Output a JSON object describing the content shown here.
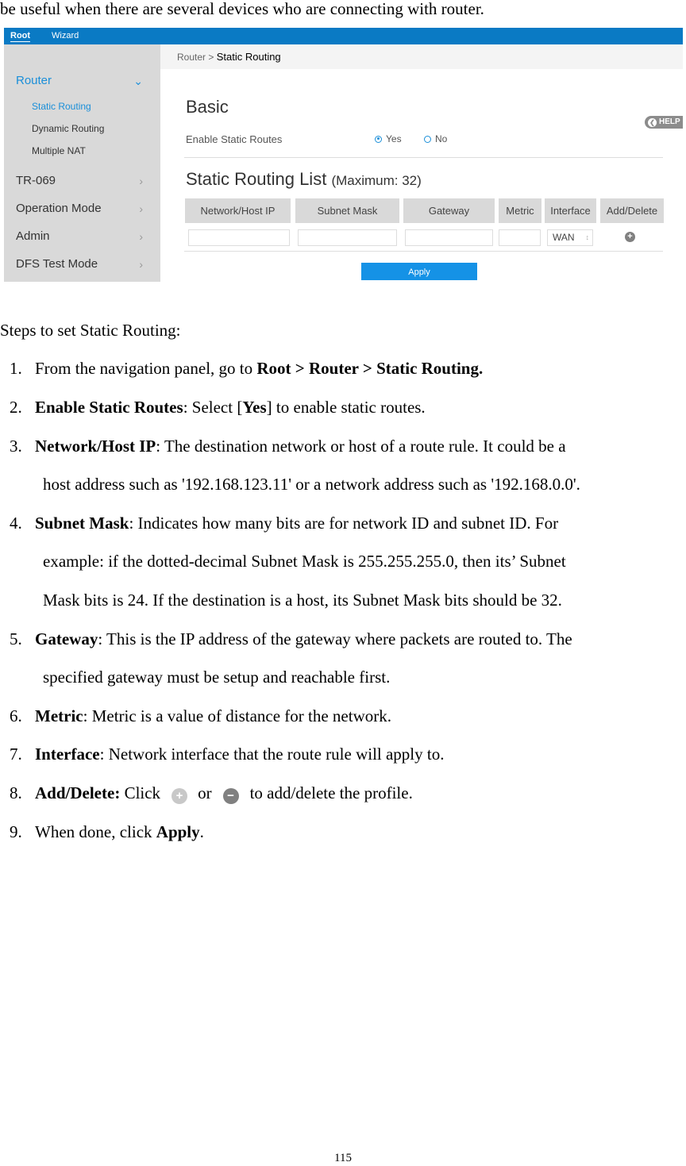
{
  "intro_text": "be useful when there are several devices who are connecting with router.",
  "screenshot": {
    "topnav": {
      "tabs": [
        "Root",
        "Wizard"
      ],
      "active": "Root"
    },
    "sidebar": {
      "items": [
        {
          "label": "Router",
          "expanded": true,
          "active": true,
          "children": [
            {
              "label": "Static Routing",
              "active": true
            },
            {
              "label": "Dynamic Routing",
              "active": false
            },
            {
              "label": "Multiple NAT",
              "active": false
            }
          ]
        },
        {
          "label": "TR-069"
        },
        {
          "label": "Operation Mode"
        },
        {
          "label": "Admin"
        },
        {
          "label": "DFS Test Mode"
        }
      ]
    },
    "breadcrumb": {
      "parent": "Router",
      "separator": ">",
      "current": "Static Routing"
    },
    "help_label": "HELP",
    "basic": {
      "title": "Basic",
      "enable_label": "Enable Static Routes",
      "options": [
        "Yes",
        "No"
      ],
      "selected": "Yes"
    },
    "list": {
      "title": "Static Routing List",
      "max_label": "(Maximum: 32)",
      "columns": [
        "Network/Host IP",
        "Subnet Mask",
        "Gateway",
        "Metric",
        "Interface",
        "Add/Delete"
      ],
      "row": {
        "network_ip": "",
        "subnet_mask": "",
        "gateway": "",
        "metric": "",
        "interface": "WAN"
      }
    },
    "apply_label": "Apply",
    "colors": {
      "accent": "#1a8fd9",
      "topnav": "#0a7ac4",
      "apply": "#1592e6",
      "sidebar": "#d9d9d9"
    }
  },
  "steps_title": "Steps to set Static Routing:",
  "steps": [
    {
      "num": "1.",
      "pre": "From the navigation panel, go to ",
      "bold": "Root > Router > Static Routing.",
      "post": ""
    },
    {
      "num": "2.",
      "bold": "Enable Static Routes",
      "mid1": ": Select [",
      "bold2": "Yes",
      "mid2": "] to enable static routes."
    },
    {
      "num": "3.",
      "bold": "Network/Host IP",
      "line1": ": The destination network or host of a route rule. It could be a",
      "line2": "host address such as '192.168.123.11' or a network address such as '192.168.0.0'."
    },
    {
      "num": "4.",
      "bold": "Subnet Mask",
      "line1": ": Indicates how many bits are for network ID and subnet ID. For",
      "line2": "example: if the dotted-decimal Subnet Mask is 255.255.255.0, then its’ Subnet",
      "line3": "Mask bits is 24. If the destination is a host, its Subnet Mask bits should be 32."
    },
    {
      "num": "5.",
      "bold": "Gateway",
      "line1": ": This is the IP address of the gateway where packets are routed to. The",
      "line2": "specified gateway must be setup and reachable first."
    },
    {
      "num": "6.",
      "bold": "Metric",
      "post": ": Metric is a value of distance for the network."
    },
    {
      "num": "7.",
      "bold": "Interface",
      "post": ": Network interface that the route rule will apply to."
    },
    {
      "num": "8.",
      "bold": "Add/Delete:",
      "pre": " Click",
      "or": "or",
      "post": "to add/delete the profile."
    },
    {
      "num": "9.",
      "pre": "When done, click ",
      "bold": "Apply",
      "post": "."
    }
  ],
  "page_number": "115"
}
